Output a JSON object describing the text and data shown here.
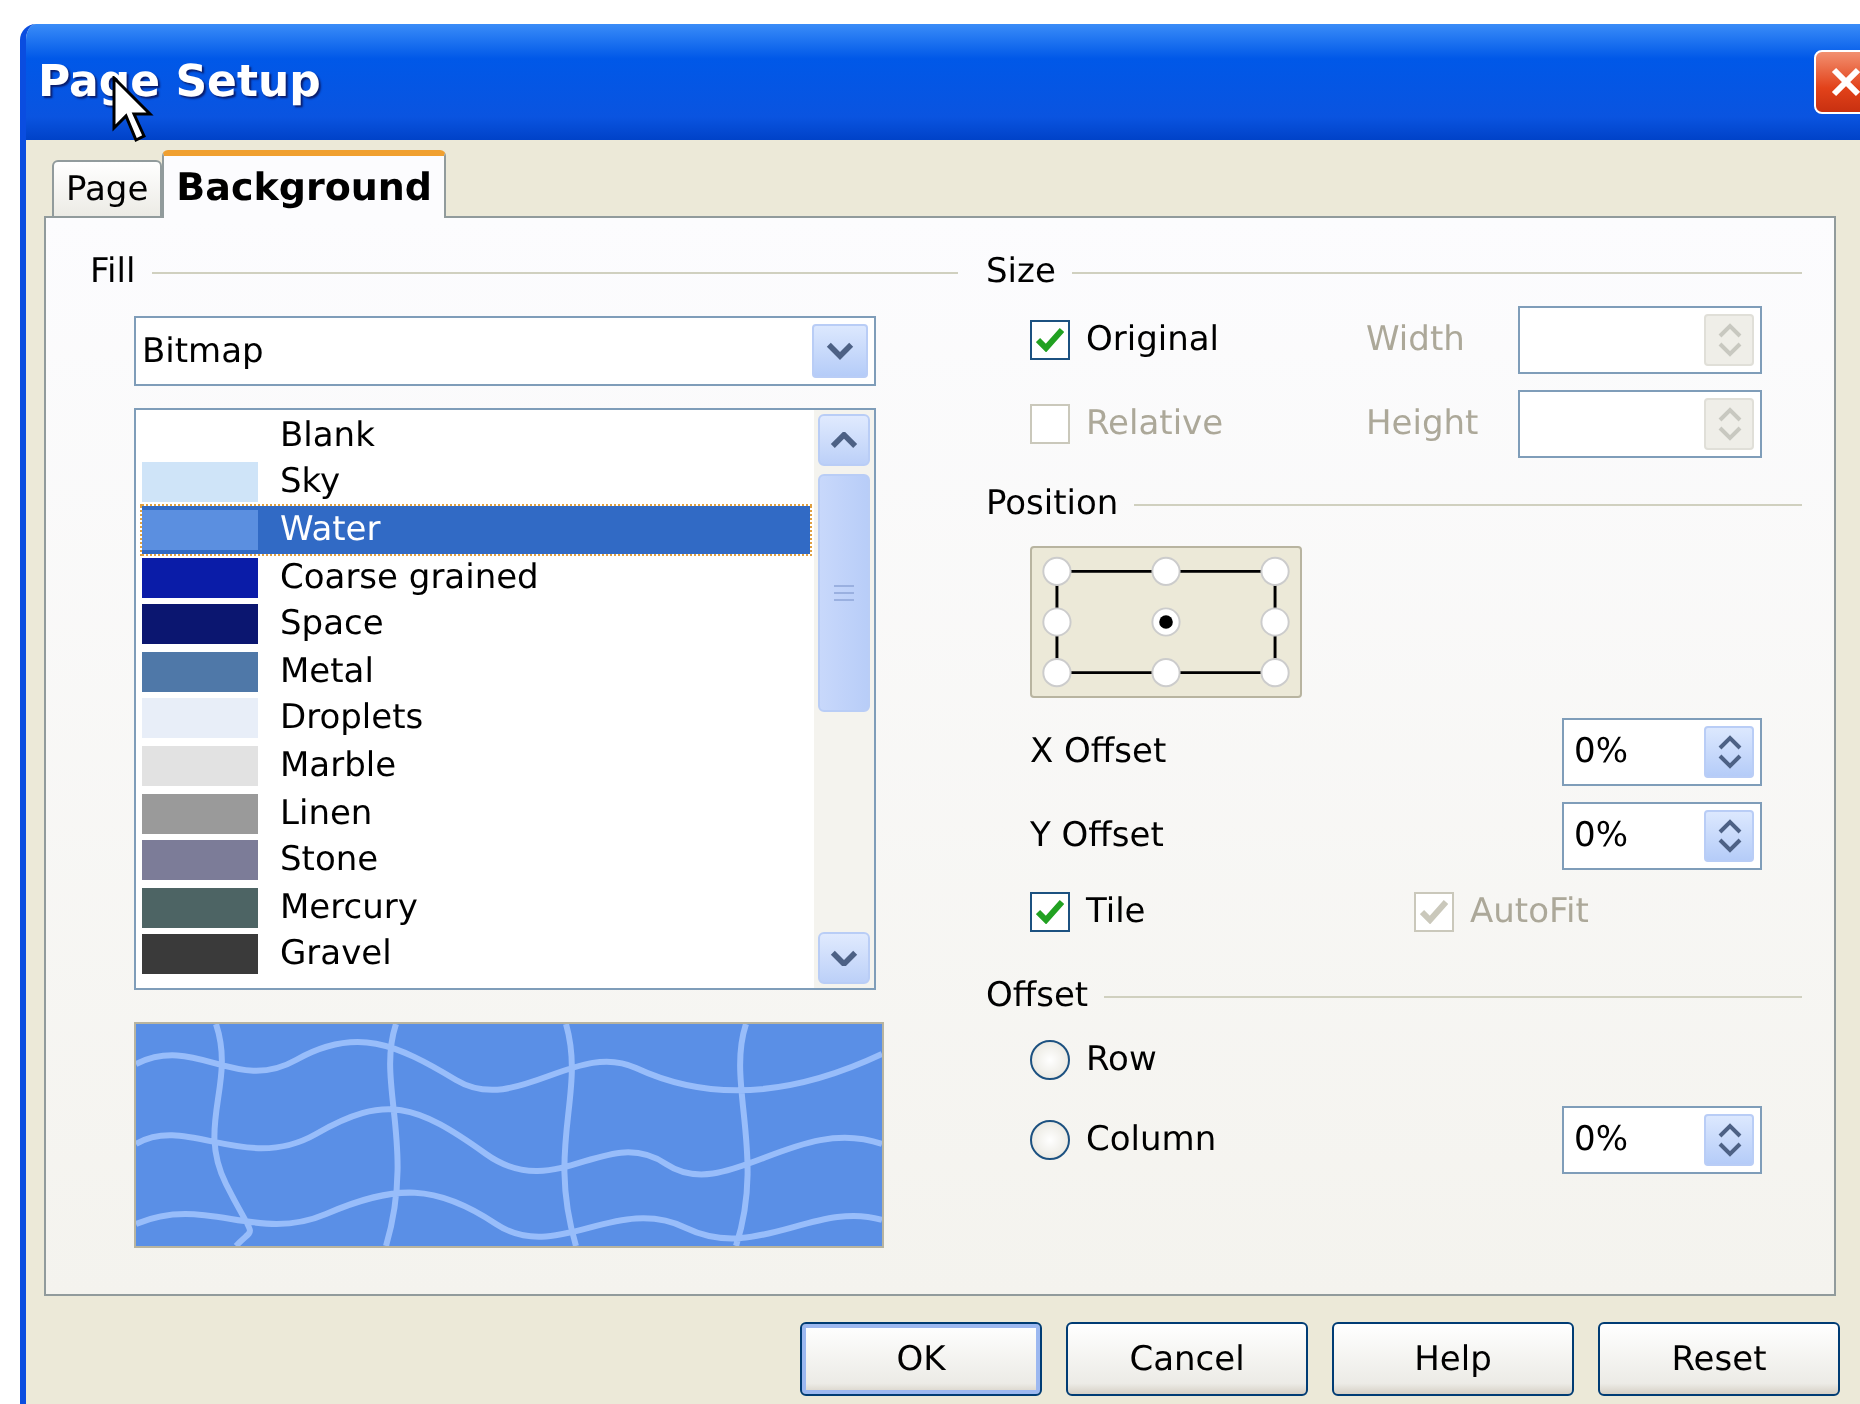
{
  "window": {
    "title": "Page Setup"
  },
  "tabs": [
    {
      "label": "Page",
      "selected": false
    },
    {
      "label": "Background",
      "selected": true
    }
  ],
  "fill": {
    "label": "Fill",
    "type": {
      "value": "Bitmap"
    },
    "bitmaps": [
      {
        "label": "Blank",
        "selected": false
      },
      {
        "label": "Sky",
        "color": "#cfe4f8",
        "selected": false
      },
      {
        "label": "Water",
        "color": "#5b8fe0",
        "selected": true
      },
      {
        "label": "Coarse grained",
        "color": "#0a1ca8",
        "selected": false
      },
      {
        "label": "Space",
        "color": "#0b1670",
        "selected": false
      },
      {
        "label": "Metal",
        "color": "#4f78a8",
        "selected": false
      },
      {
        "label": "Droplets",
        "color": "#e8eef8",
        "selected": false
      },
      {
        "label": "Marble",
        "color": "#e2e2e2",
        "selected": false
      },
      {
        "label": "Linen",
        "color": "#9a9a9a",
        "selected": false
      },
      {
        "label": "Stone",
        "color": "#7c7c98",
        "selected": false
      },
      {
        "label": "Mercury",
        "color": "#4d6464",
        "selected": false
      },
      {
        "label": "Gravel",
        "color": "#3a3a3a",
        "selected": false
      }
    ]
  },
  "size": {
    "label": "Size",
    "original": {
      "label": "Original",
      "checked": true,
      "disabled": false
    },
    "relative": {
      "label": "Relative",
      "checked": false,
      "disabled": true
    },
    "width": {
      "label": "Width",
      "disabled": true
    },
    "height": {
      "label": "Height",
      "disabled": true
    }
  },
  "position": {
    "label": "Position",
    "points": [
      {
        "selected": false
      },
      {
        "selected": false
      },
      {
        "selected": false
      },
      {
        "selected": false
      },
      {
        "selected": true
      },
      {
        "selected": false
      },
      {
        "selected": false
      },
      {
        "selected": false
      },
      {
        "selected": false
      }
    ],
    "x_offset": {
      "label": "X Offset",
      "value": "0%"
    },
    "y_offset": {
      "label": "Y Offset",
      "value": "0%"
    },
    "tile": {
      "label": "Tile",
      "checked": true,
      "disabled": false
    },
    "autofit": {
      "label": "AutoFit",
      "checked": true,
      "disabled": true
    }
  },
  "offset": {
    "label": "Offset",
    "row": {
      "label": "Row",
      "selected": false
    },
    "column": {
      "label": "Column",
      "selected": false
    },
    "value": "0%"
  },
  "buttons": [
    {
      "label": "OK",
      "default": true
    },
    {
      "label": "Cancel",
      "default": false
    },
    {
      "label": "Help",
      "default": false
    },
    {
      "label": "Reset",
      "default": false
    }
  ]
}
